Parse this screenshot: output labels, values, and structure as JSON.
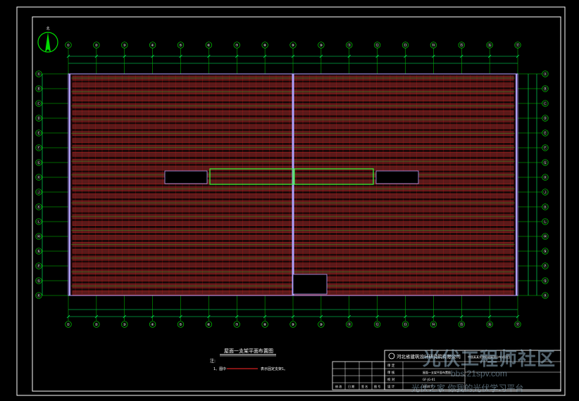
{
  "drawing": {
    "title": "屋面一支架平面布置图",
    "note_label": "注:",
    "note_item_prefix": "1、图中",
    "note_item_suffix": "表示固定支架1。",
    "north_label": "北"
  },
  "grid": {
    "top_axes": [
      "①",
      "②",
      "③",
      "④",
      "⑤",
      "⑥",
      "⑦",
      "⑧",
      "⑨",
      "⑩",
      "⑪",
      "⑫",
      "⑬",
      "⑭",
      "⑮",
      "⑯",
      "⑰"
    ],
    "right_axes": [
      "Ⓐ",
      "Ⓑ",
      "Ⓒ",
      "Ⓓ",
      "Ⓔ",
      "Ⓕ",
      "Ⓖ",
      "Ⓗ",
      "Ⓙ",
      "Ⓚ",
      "Ⓛ",
      "Ⓜ",
      "Ⓝ",
      "Ⓟ",
      "Ⓠ",
      "Ⓡ"
    ],
    "left_axes": [
      "Ⓐ",
      "Ⓑ",
      "Ⓒ",
      "Ⓓ",
      "Ⓔ",
      "Ⓕ",
      "Ⓖ",
      "Ⓗ",
      "Ⓙ",
      "Ⓚ",
      "Ⓛ",
      "Ⓜ",
      "Ⓝ",
      "Ⓟ",
      "Ⓠ",
      "Ⓡ"
    ]
  },
  "title_block": {
    "company": "河北省建筑设计研究院有限公司",
    "project": "中国某某光伏电站屋顶分布式项目",
    "rows": [
      {
        "label": "审 定",
        "value": ""
      },
      {
        "label": "审 核",
        "value": ""
      },
      {
        "label": "校 对",
        "value": ""
      },
      {
        "label": "设 计",
        "value": ""
      }
    ],
    "drawing_name": "屋面一支架平面布置图",
    "drawing_no": "GF-JG-01",
    "date": "2016.3",
    "small_labels": [
      "修 改",
      "日 期",
      "签 名",
      "图 号"
    ]
  },
  "watermark": {
    "brand": "光伏工程师社区",
    "url": "bbs.21spv.com",
    "slogan": "光伏之家 你我的光伏学习平台"
  },
  "colors": {
    "background": "#000000",
    "frame": "#ffffff",
    "grid_lines": "#00cc00",
    "panel_red": "#d42020",
    "panel_fill": "#5a1a1a",
    "roof_edge": "#b0a0ff",
    "dims": "#00ff66"
  }
}
